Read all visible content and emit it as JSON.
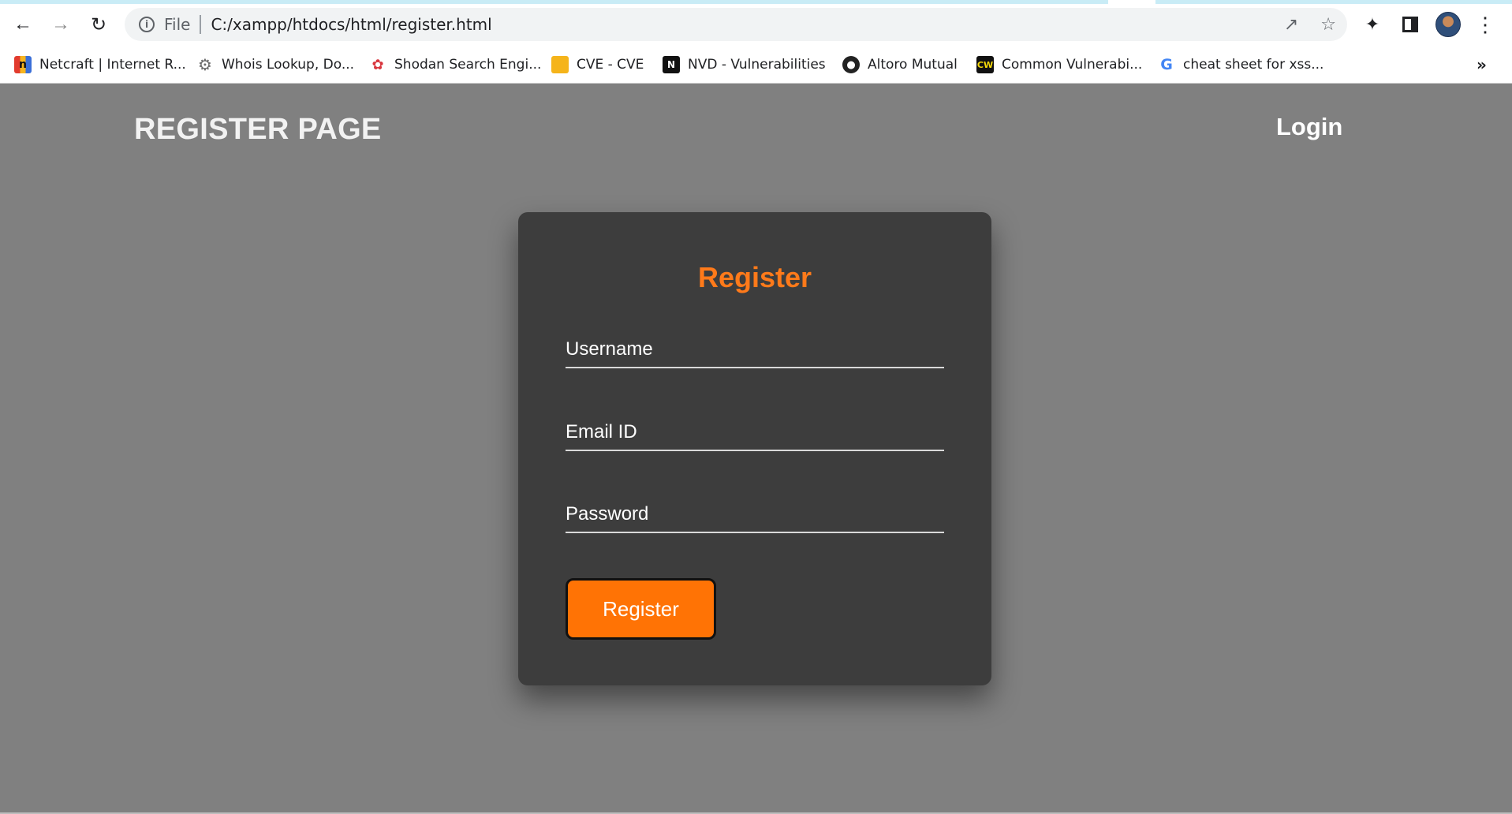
{
  "browser": {
    "address": {
      "scheme": "File",
      "url": "C:/xampp/htdocs/html/register.html"
    },
    "bookmarks": [
      {
        "label": "Netcraft | Internet R...",
        "icon": "netcraft-icon"
      },
      {
        "label": "Whois Lookup, Do...",
        "icon": "whois-gear-icon"
      },
      {
        "label": "Shodan Search Engi...",
        "icon": "shodan-icon"
      },
      {
        "label": "CVE - CVE",
        "icon": "cve-folder-icon"
      },
      {
        "label": "NVD - Vulnerabilities",
        "icon": "nvd-icon"
      },
      {
        "label": "Altoro Mutual",
        "icon": "globe-icon"
      },
      {
        "label": "Common Vulnerabi...",
        "icon": "cwe-icon"
      },
      {
        "label": "cheat sheet for xss...",
        "icon": "google-icon"
      }
    ],
    "bookmarks_more": "»"
  },
  "header": {
    "title": "REGISTER PAGE",
    "login_label": "Login"
  },
  "form": {
    "title": "Register",
    "username_placeholder": "Username",
    "email_placeholder": "Email ID",
    "password_placeholder": "Password",
    "submit_label": "Register"
  },
  "colors": {
    "page_background": "#808080",
    "card_background": "#3d3d3d",
    "accent_orange": "#ff7305"
  }
}
